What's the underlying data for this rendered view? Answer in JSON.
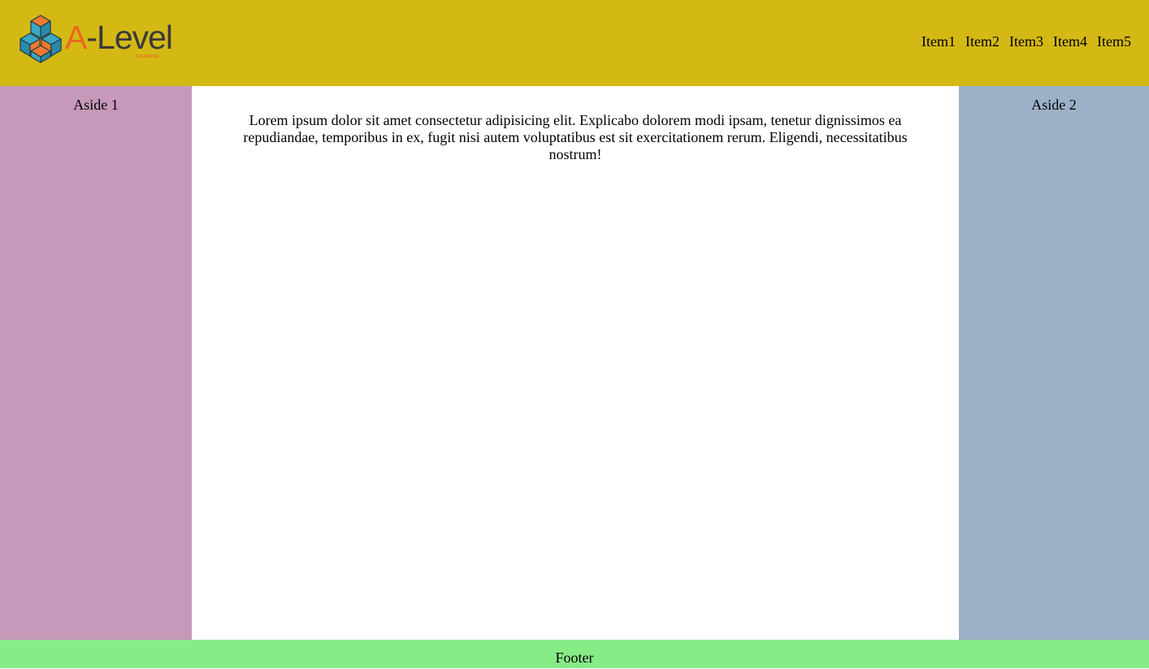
{
  "header": {
    "logo": {
      "text_prefix": "A",
      "text_rest": "-Level",
      "subtitle": "UKRAINE",
      "icon": "cube-cluster-logo-icon"
    },
    "nav": [
      "Item1",
      "Item2",
      "Item3",
      "Item4",
      "Item5"
    ]
  },
  "aside_left": {
    "title": "Aside 1"
  },
  "aside_right": {
    "title": "Aside 2"
  },
  "main": {
    "text": "Lorem ipsum dolor sit amet consectetur adipisicing elit. Explicabo dolorem modi ipsam, tenetur dignissimos ea repudiandae, temporibus in ex, fugit nisi autem voluptatibus est sit exercitationem rerum. Eligendi, necessitatibus nostrum!"
  },
  "footer": {
    "text": "Footer"
  },
  "colors": {
    "header_bg": "#d4b915",
    "aside_left_bg": "#c698b9",
    "aside_right_bg": "#9cb1c8",
    "footer_bg": "#87eb87",
    "logo_accent": "#ea6a1e",
    "logo_cube_blue": "#3aa6c4"
  }
}
